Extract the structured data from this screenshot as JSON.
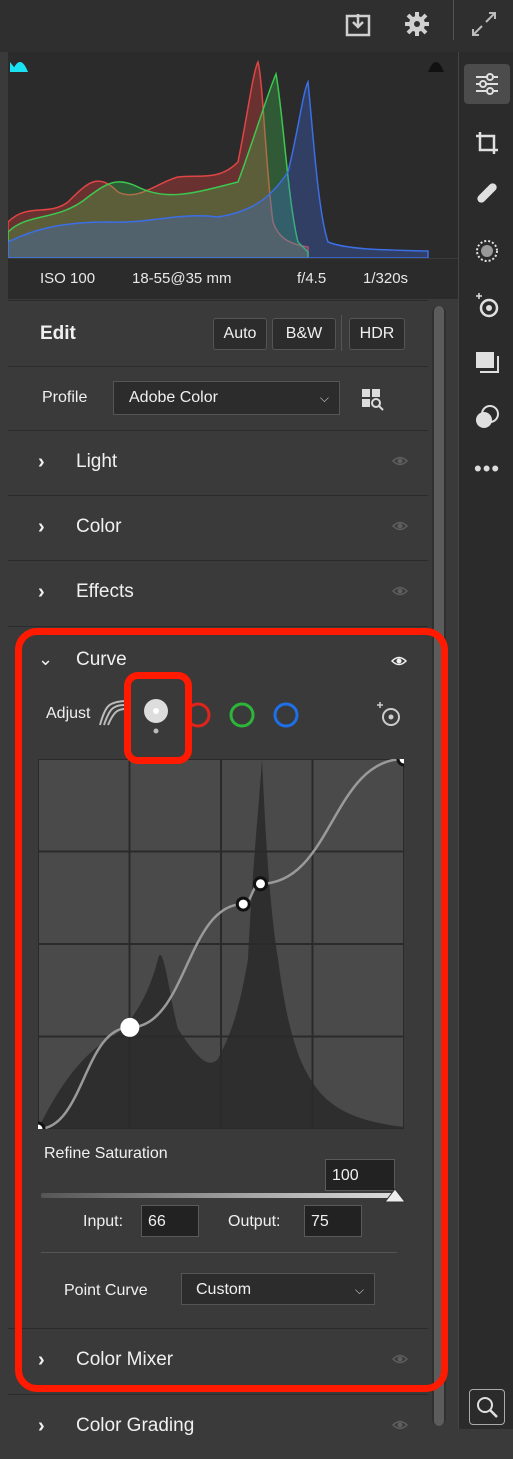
{
  "exif": {
    "iso": "ISO 100",
    "lens": "18-55@35 mm",
    "aperture": "f/4.5",
    "shutter": "1/320s"
  },
  "edit": {
    "title": "Edit",
    "auto": "Auto",
    "bw": "B&W",
    "hdr": "HDR"
  },
  "profile": {
    "label": "Profile",
    "value": "Adobe Color"
  },
  "sections": {
    "light": "Light",
    "color": "Color",
    "effects": "Effects",
    "curve": "Curve",
    "color_mixer": "Color Mixer",
    "color_grading": "Color Grading"
  },
  "curve": {
    "adjust_label": "Adjust",
    "refine_label": "Refine Saturation",
    "refine_value": "100",
    "refine_fraction": 1.0,
    "input_label": "Input:",
    "input_value": "66",
    "output_label": "Output:",
    "output_value": "75",
    "point_curve_label": "Point Curve",
    "point_curve_value": "Custom",
    "points": [
      [
        0,
        0
      ],
      [
        64,
        70
      ],
      [
        143,
        155
      ],
      [
        155,
        169
      ],
      [
        255,
        255
      ]
    ]
  },
  "colors": {
    "accent_red": "#ff1a00",
    "channel_red": "#e0241c",
    "channel_green": "#2db53a",
    "channel_blue": "#1e6fe8"
  },
  "icons": [
    "download-icon",
    "gear-icon",
    "expand-icon",
    "sliders-icon",
    "crop-icon",
    "healing-icon",
    "mask-icon",
    "red-eye-icon",
    "presets-icon",
    "snapshot-icon",
    "more-icon",
    "zoom-icon"
  ]
}
